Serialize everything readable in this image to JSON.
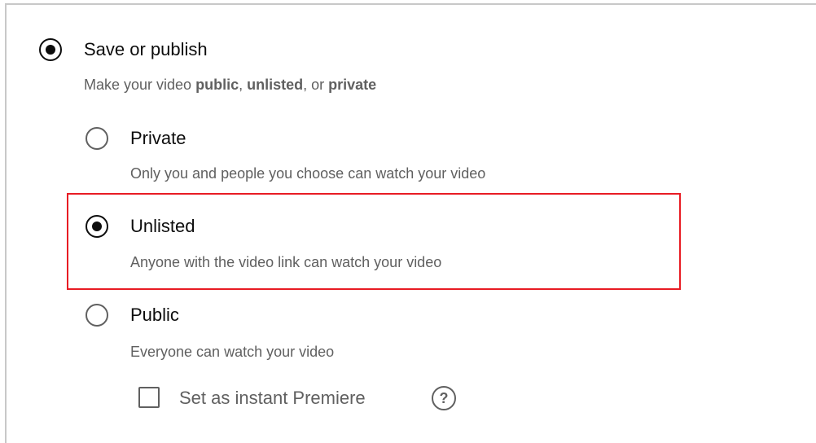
{
  "save_or_publish": {
    "title": "Save or publish",
    "description": {
      "prefix": "Make your video ",
      "public": "public",
      "sep1": ", ",
      "unlisted": "unlisted",
      "sep2": ", or ",
      "private": "private"
    },
    "checked": true
  },
  "visibility_options": [
    {
      "title": "Private",
      "description": "Only you and people you choose can watch your video",
      "checked": false
    },
    {
      "title": "Unlisted",
      "description": "Anyone with the video link can watch your video",
      "checked": true,
      "highlighted": true
    },
    {
      "title": "Public",
      "description": "Everyone can watch your video",
      "checked": false
    }
  ],
  "premiere": {
    "label": "Set as instant Premiere",
    "checked": false,
    "help_glyph": "?",
    "help_icon": "help-circle-icon"
  },
  "colors": {
    "highlight_border": "#e81c24",
    "text_primary": "#0d0d0d",
    "text_secondary": "#606060"
  }
}
